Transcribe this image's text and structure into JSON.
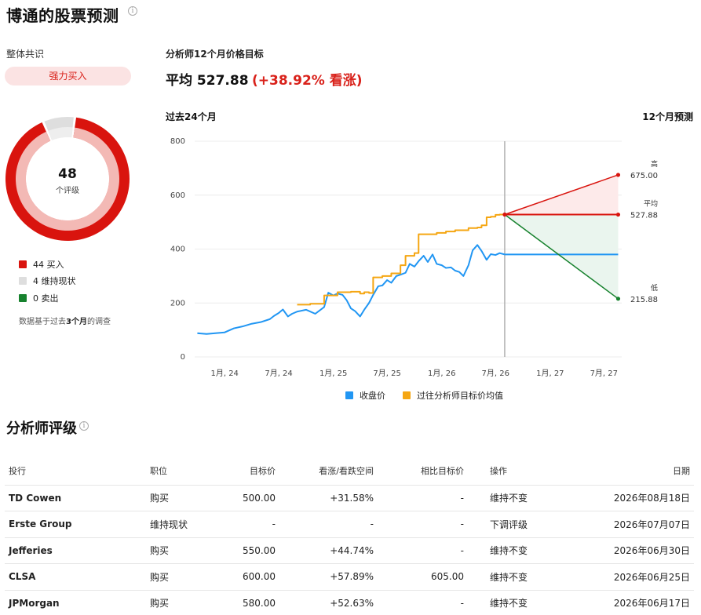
{
  "page": {
    "title": "博通的股票预测"
  },
  "consensus": {
    "label": "整体共识",
    "rating": "强力买入",
    "total": "48",
    "total_sub": "个评级",
    "breakdown": [
      {
        "label": "44 买入",
        "count": 44,
        "color": "#d9140e"
      },
      {
        "label": "4 维持现状",
        "count": 4,
        "color": "#dedede"
      },
      {
        "label": "0 卖出",
        "count": 0,
        "color": "#17822e"
      }
    ],
    "note_pre": "数据基于过去",
    "note_bold": "3个月",
    "note_post": "的调查"
  },
  "target": {
    "label": "分析师12个月价格目标",
    "avg_text": "平均 527.88",
    "pct_text": "(+38.92% 看涨)"
  },
  "chart_labels": {
    "past": "过去24个月",
    "future": "12个月预测"
  },
  "chart_data": {
    "type": "line",
    "ylim": [
      0,
      800
    ],
    "y_ticks": [
      0,
      200,
      400,
      600,
      800
    ],
    "x_ticks": [
      "1月, 24",
      "7月, 24",
      "1月, 25",
      "7月, 25",
      "1月, 26",
      "7月, 26",
      "1月, 27",
      "7月, 27"
    ],
    "series": [
      {
        "name": "收盘价",
        "color": "#2196f3",
        "points": [
          [
            "2023-10-01",
            88
          ],
          [
            "2023-11-01",
            85
          ],
          [
            "2023-12-01",
            88
          ],
          [
            "2024-01-01",
            91
          ],
          [
            "2024-02-01",
            106
          ],
          [
            "2024-03-01",
            113
          ],
          [
            "2024-04-01",
            123
          ],
          [
            "2024-05-01",
            129
          ],
          [
            "2024-06-01",
            140
          ],
          [
            "2024-06-15",
            152
          ],
          [
            "2024-07-01",
            163
          ],
          [
            "2024-07-15",
            176
          ],
          [
            "2024-08-01",
            150
          ],
          [
            "2024-08-15",
            160
          ],
          [
            "2024-09-01",
            168
          ],
          [
            "2024-10-01",
            175
          ],
          [
            "2024-11-01",
            160
          ],
          [
            "2024-12-01",
            185
          ],
          [
            "2024-12-15",
            238
          ],
          [
            "2025-01-01",
            228
          ],
          [
            "2025-01-15",
            235
          ],
          [
            "2025-02-01",
            230
          ],
          [
            "2025-02-15",
            210
          ],
          [
            "2025-03-01",
            180
          ],
          [
            "2025-03-15",
            170
          ],
          [
            "2025-04-01",
            150
          ],
          [
            "2025-04-15",
            175
          ],
          [
            "2025-05-01",
            200
          ],
          [
            "2025-05-15",
            230
          ],
          [
            "2025-06-01",
            262
          ],
          [
            "2025-06-15",
            265
          ],
          [
            "2025-07-01",
            285
          ],
          [
            "2025-07-15",
            275
          ],
          [
            "2025-08-01",
            300
          ],
          [
            "2025-08-15",
            305
          ],
          [
            "2025-09-01",
            312
          ],
          [
            "2025-09-15",
            345
          ],
          [
            "2025-10-01",
            335
          ],
          [
            "2025-10-15",
            355
          ],
          [
            "2025-11-01",
            375
          ],
          [
            "2025-11-15",
            352
          ],
          [
            "2025-12-01",
            380
          ],
          [
            "2025-12-15",
            345
          ],
          [
            "2026-01-01",
            340
          ],
          [
            "2026-01-15",
            330
          ],
          [
            "2026-02-01",
            332
          ],
          [
            "2026-02-15",
            320
          ],
          [
            "2026-03-01",
            315
          ],
          [
            "2026-03-15",
            300
          ],
          [
            "2026-04-01",
            340
          ],
          [
            "2026-04-15",
            395
          ],
          [
            "2026-05-01",
            415
          ],
          [
            "2026-05-15",
            393
          ],
          [
            "2026-06-01",
            360
          ],
          [
            "2026-06-15",
            381
          ],
          [
            "2026-07-01",
            378
          ],
          [
            "2026-07-15",
            385
          ],
          [
            "2026-08-01",
            380
          ]
        ]
      },
      {
        "name": "过往分析师目标价均值",
        "color": "#f5a612",
        "step": true,
        "points": [
          [
            "2024-09-01",
            194
          ],
          [
            "2024-10-15",
            197
          ],
          [
            "2024-12-01",
            228
          ],
          [
            "2025-01-15",
            240
          ],
          [
            "2025-03-01",
            242
          ],
          [
            "2025-04-01",
            235
          ],
          [
            "2025-04-15",
            240
          ],
          [
            "2025-05-01",
            237
          ],
          [
            "2025-05-15",
            295
          ],
          [
            "2025-06-15",
            300
          ],
          [
            "2025-07-15",
            310
          ],
          [
            "2025-08-15",
            340
          ],
          [
            "2025-09-01",
            375
          ],
          [
            "2025-10-01",
            385
          ],
          [
            "2025-10-15",
            455
          ],
          [
            "2025-12-01",
            455
          ],
          [
            "2025-12-15",
            460
          ],
          [
            "2026-01-15",
            465
          ],
          [
            "2026-02-15",
            470
          ],
          [
            "2026-03-15",
            470
          ],
          [
            "2026-04-01",
            478
          ],
          [
            "2026-05-01",
            480
          ],
          [
            "2026-05-15",
            488
          ],
          [
            "2026-06-01",
            518
          ],
          [
            "2026-06-15",
            520
          ],
          [
            "2026-07-01",
            527
          ],
          [
            "2026-07-15",
            528
          ],
          [
            "2026-08-01",
            528
          ]
        ]
      }
    ],
    "forecast": {
      "start": [
        "2026-08-01",
        528
      ],
      "current": 380,
      "end_date": "2027-08-18",
      "high": {
        "label": "高",
        "value_text": "675.00",
        "value": 675
      },
      "avg": {
        "label": "平均",
        "value_text": "527.88",
        "value": 527.88
      },
      "low": {
        "label": "低",
        "value_text": "215.88",
        "value": 215.88
      }
    },
    "legend": "bottom"
  },
  "chart_colors": {
    "close": "#2196f3",
    "target": "#f5a612",
    "high": "#d9140e",
    "low": "#17822e",
    "divider": "#b0b0b0"
  },
  "ratings": {
    "title": "分析师评级",
    "headers": [
      "投行",
      "职位",
      "目标价",
      "看涨/看跌空间",
      "相比目标价",
      "操作",
      "日期"
    ],
    "rows": [
      {
        "firm": "TD Cowen",
        "position": "购买",
        "buy": true,
        "target": "500.00",
        "upside": "+31.58%",
        "vs": "-",
        "action": "维持不变",
        "date": "2026年08月18日"
      },
      {
        "firm": "Erste Group",
        "position": "维持现状",
        "buy": false,
        "target": "-",
        "upside": "-",
        "vs": "-",
        "action": "下调评级",
        "date": "2026年07月07日"
      },
      {
        "firm": "Jefferies",
        "position": "购买",
        "buy": true,
        "target": "550.00",
        "upside": "+44.74%",
        "vs": "-",
        "action": "维持不变",
        "date": "2026年06月30日"
      },
      {
        "firm": "CLSA",
        "position": "购买",
        "buy": true,
        "target": "600.00",
        "upside": "+57.89%",
        "vs": "605.00",
        "action": "维持不变",
        "date": "2026年06月25日"
      },
      {
        "firm": "JPMorgan",
        "position": "购买",
        "buy": true,
        "target": "580.00",
        "upside": "+52.63%",
        "vs": "-",
        "action": "维持不变",
        "date": "2026年06月17日"
      }
    ]
  }
}
